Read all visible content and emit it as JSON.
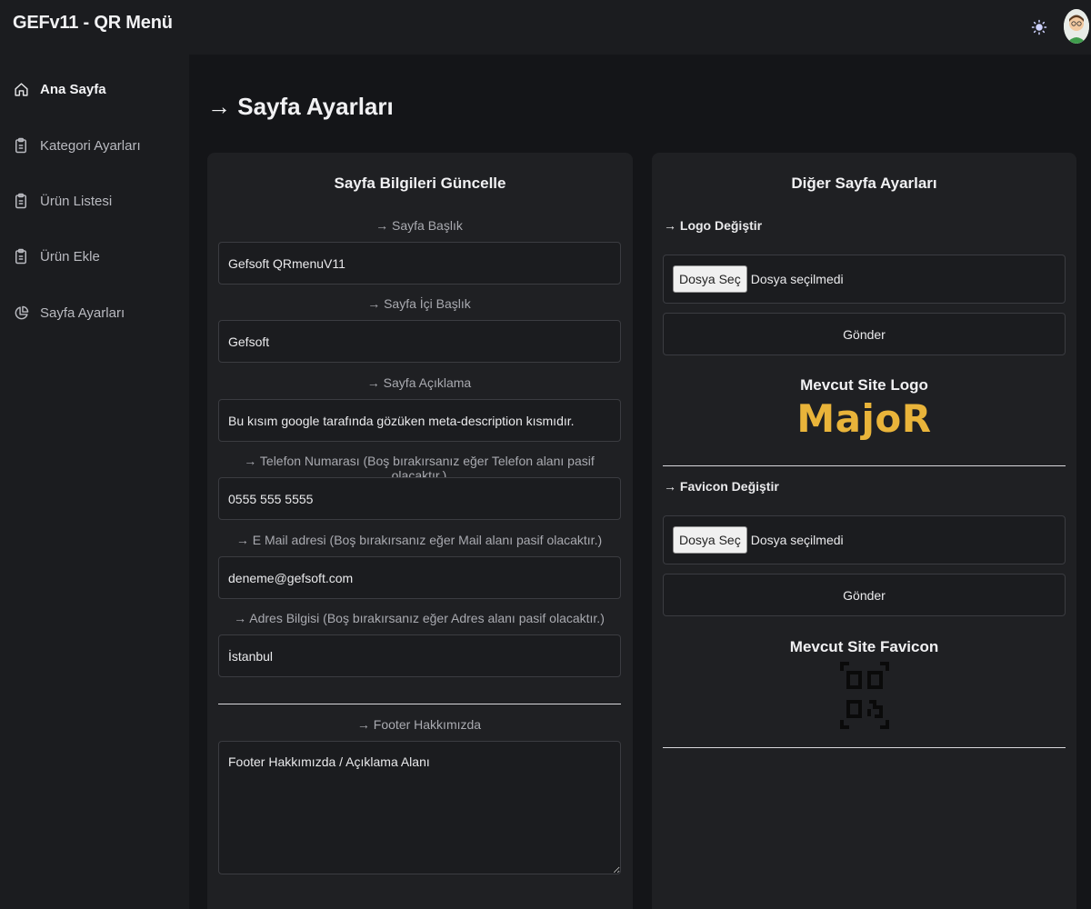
{
  "app": {
    "title": "GEFv11 - QR Menü"
  },
  "header": {
    "theme_icon": "sun-icon",
    "avatar_icon": "user-avatar"
  },
  "sidebar": {
    "items": [
      {
        "label": "Ana Sayfa",
        "icon": "home-icon",
        "active": true
      },
      {
        "label": "Kategori Ayarları",
        "icon": "clipboard-icon"
      },
      {
        "label": "Ürün Listesi",
        "icon": "clipboard-icon"
      },
      {
        "label": "Ürün Ekle",
        "icon": "clipboard-icon"
      },
      {
        "label": "Sayfa Ayarları",
        "icon": "pie-chart-icon"
      }
    ]
  },
  "page": {
    "title": "→ Sayfa Ayarları"
  },
  "left_card": {
    "title": "Sayfa Bilgileri Güncelle",
    "fields": [
      {
        "label": "→ Sayfa Başlık",
        "value": "Gefsoft QRmenuV11"
      },
      {
        "label": "→ Sayfa İçi Başlık",
        "value": "Gefsoft"
      },
      {
        "label": "→ Sayfa Açıklama",
        "value": "Bu kısım google tarafında gözüken meta-description kısmıdır."
      },
      {
        "label": "→ Telefon Numarası (Boş bırakırsanız eğer Telefon alanı pasif olacaktır.)",
        "value": "0555 555 5555"
      },
      {
        "label": "→ E Mail adresi (Boş bırakırsanız eğer Mail alanı pasif olacaktır.)",
        "value": "deneme@gefsoft.com"
      },
      {
        "label": "→ Adres Bilgisi (Boş bırakırsanız eğer Adres alanı pasif olacaktır.)",
        "value": "İstanbul"
      }
    ],
    "footer": {
      "label": "→ Footer Hakkımızda",
      "value": "Footer Hakkımızda / Açıklama Alanı"
    }
  },
  "right_card": {
    "title": "Diğer Sayfa Ayarları",
    "logo": {
      "label": "→ Logo Değiştir",
      "file_button": "Dosya Seç",
      "file_status": "Dosya seçilmedi",
      "submit": "Gönder",
      "current_title": "Mevcut Site Logo",
      "current_logo_text": "MajoR",
      "logo_color": "#e9b43a"
    },
    "favicon": {
      "label": "→ Favicon Değiştir",
      "file_button": "Dosya Seç",
      "file_status": "Dosya seçilmedi",
      "submit": "Gönder",
      "current_title": "Mevcut Site Favicon",
      "current_icon": "qr-code-icon"
    }
  }
}
